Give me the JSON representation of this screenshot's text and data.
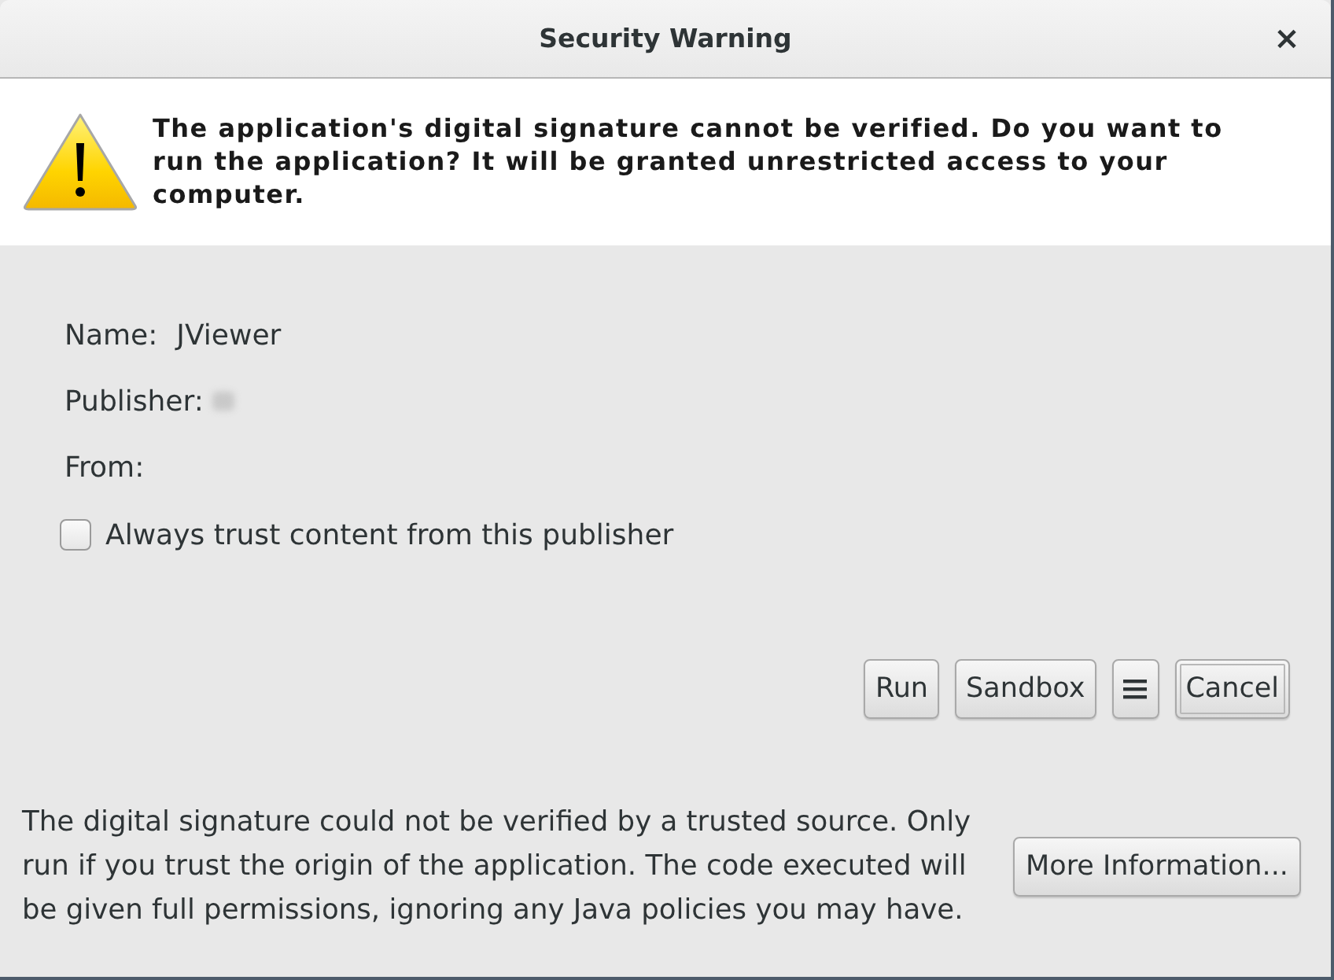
{
  "window": {
    "title": "Security Warning",
    "close_glyph": "×"
  },
  "message": "The application's digital signature cannot be verified. Do you want to run the application? It will be granted unrestricted access to your computer.",
  "details": [
    {
      "label": "Name:",
      "value": "JViewer",
      "redacted": false
    },
    {
      "label": "Publisher:",
      "redacted": true
    },
    {
      "label": "From:",
      "redacted": false
    }
  ],
  "trust_checkbox": {
    "label": "Always trust content from this publisher",
    "checked": false
  },
  "buttons": [
    {
      "kind": "text",
      "label": "Run",
      "focused": false
    },
    {
      "kind": "text",
      "label": "Sandbox",
      "focused": false
    },
    {
      "kind": "menu",
      "focused": false
    },
    {
      "kind": "text",
      "label": "Cancel",
      "focused": true
    }
  ],
  "footer": {
    "text": "The digital signature could not be verified by a trusted source. Only run if you trust the origin of the application. The code executed will be given full permissions, ignoring any Java policies you may have.",
    "button": "More Information..."
  }
}
